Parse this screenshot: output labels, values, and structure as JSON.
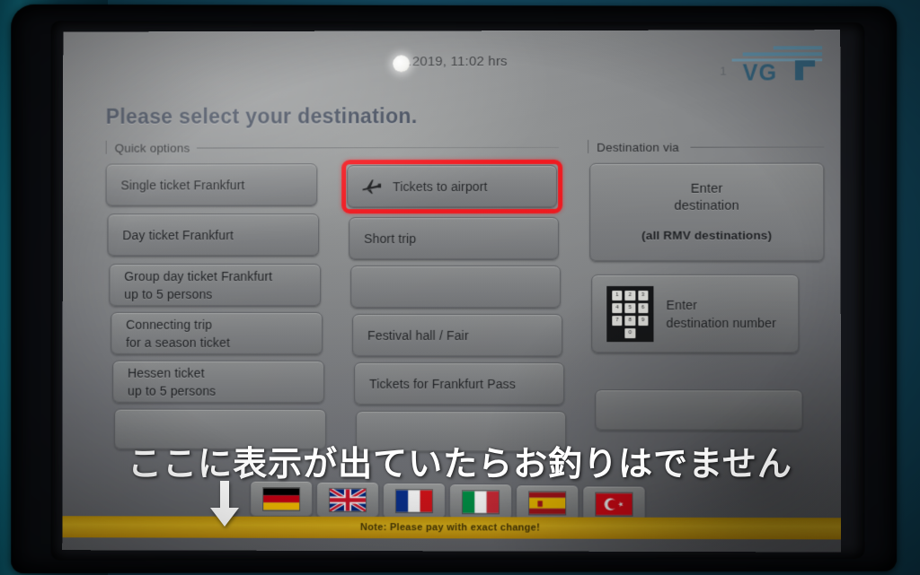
{
  "machine": {
    "brand_logo": "vgf-logo",
    "page_number": "1"
  },
  "header": {
    "datetime": "12.2019, 11:02 hrs"
  },
  "headline": "Please select your destination.",
  "sections": {
    "quick_options": {
      "label": "Quick options",
      "left_buttons": [
        {
          "line1": "Single ticket Frankfurt",
          "line2": ""
        },
        {
          "line1": "Day ticket Frankfurt",
          "line2": ""
        },
        {
          "line1": "Group day ticket Frankfurt",
          "line2": "up to 5 persons"
        },
        {
          "line1": "Connecting trip",
          "line2": "for a season ticket"
        },
        {
          "line1": "Hessen ticket",
          "line2": "up to 5 persons"
        }
      ],
      "middle_buttons": [
        {
          "line1": "Tickets to airport",
          "line2": "",
          "icon": "airplane-icon",
          "highlighted": true
        },
        {
          "line1": "Short trip",
          "line2": "",
          "icon": "",
          "highlighted": false
        },
        {
          "line1": "Festival hall / Fair",
          "line2": "",
          "icon": "",
          "highlighted": false
        },
        {
          "line1": "Tickets for Frankfurt Pass",
          "line2": "",
          "icon": "",
          "highlighted": false
        }
      ]
    },
    "destination_via": {
      "label": "Destination via",
      "enter_destination": {
        "line1": "Enter",
        "line2": "destination",
        "line3": "(all RMV destinations)"
      },
      "enter_destination_number": {
        "line1": "Enter",
        "line2": "destination number",
        "icon": "numeric-keypad-icon",
        "keys": [
          "1",
          "2",
          "3",
          "4",
          "5",
          "6",
          "7",
          "8",
          "9",
          "0"
        ]
      }
    }
  },
  "language_bar": [
    {
      "name": "german-flag",
      "country": "Germany"
    },
    {
      "name": "uk-flag",
      "country": "United Kingdom"
    },
    {
      "name": "french-flag",
      "country": "France"
    },
    {
      "name": "italian-flag",
      "country": "Italy"
    },
    {
      "name": "spanish-flag",
      "country": "Spain"
    },
    {
      "name": "turkish-flag",
      "country": "Turkey"
    }
  ],
  "notice": "Note: Please pay with exact change!",
  "annotation": {
    "japanese_text": "ここに表示が出ていたらお釣りはでません",
    "arrow": "down-arrow-icon",
    "highlight_color": "#f21b21",
    "text_color": "#ffffff"
  },
  "colors": {
    "machine_body": "#14495c",
    "bezel": "#0b0d11",
    "screen_bg": "#77797a",
    "button_face": "#828486",
    "headline_text": "#3d4657",
    "notice_bar": "#d7a714",
    "highlight": "#f21b21"
  }
}
